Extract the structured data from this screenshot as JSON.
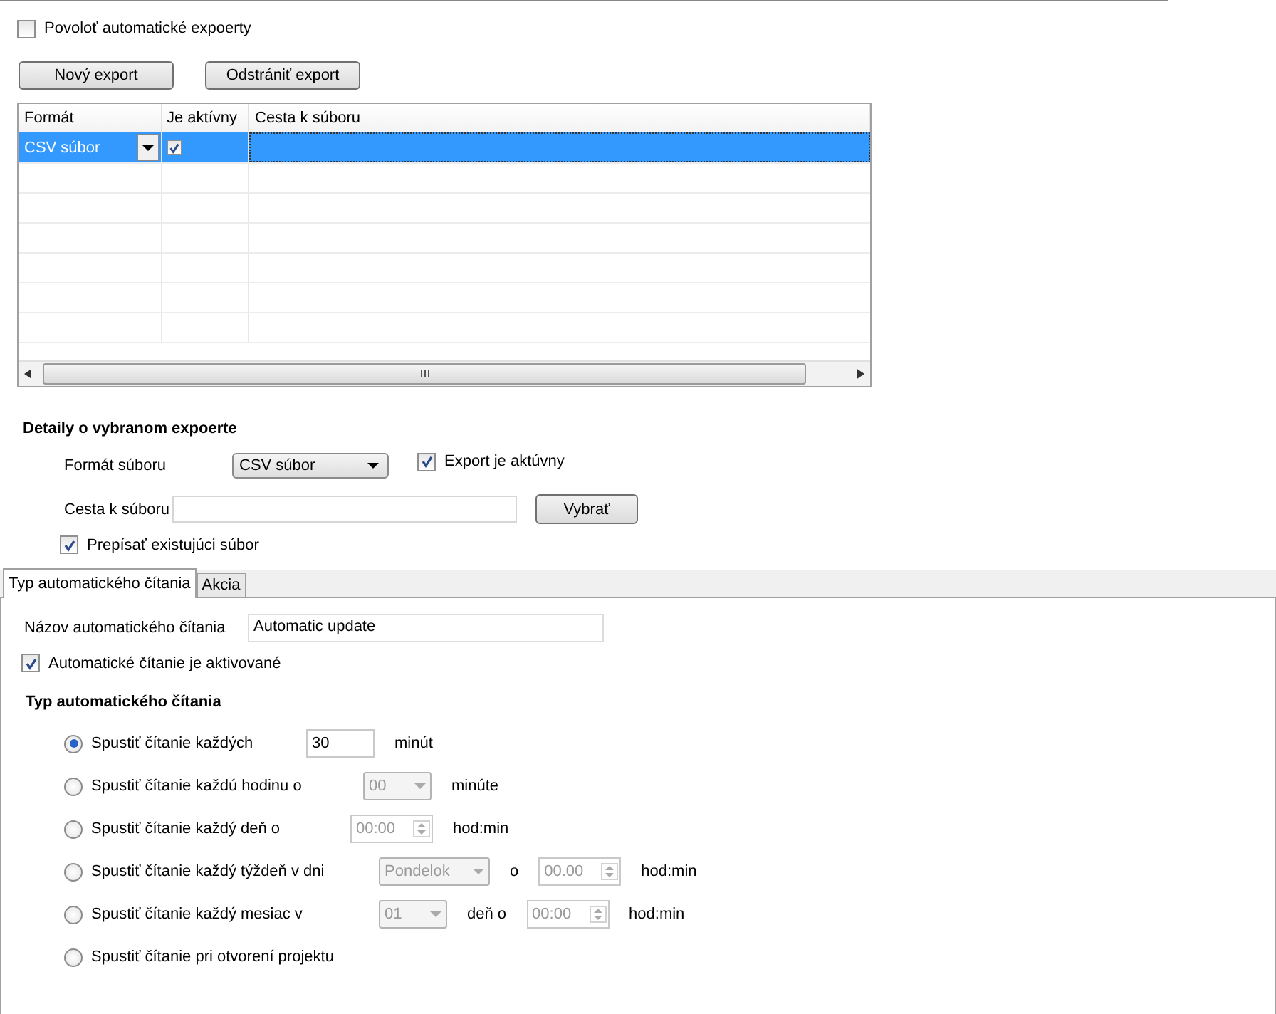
{
  "enable_auto_exports": {
    "label": "Povoloť automatické expoerty",
    "checked": false
  },
  "buttons": [
    "Nový export",
    "Odstrániť export"
  ],
  "table": {
    "columns": [
      "Formát",
      "Je aktívny",
      "Cesta k súboru"
    ],
    "rows": [
      {
        "format": "CSV súbor",
        "active": true,
        "path": "",
        "selected": true
      }
    ]
  },
  "details": {
    "title": "Detaily o vybranom expoerte",
    "format_label": "Formát súboru",
    "format_value": "CSV súbor",
    "active_label": "Export je aktúvny",
    "active_checked": true,
    "path_label": "Cesta k súboru",
    "browse_button": "Vybrať",
    "overwrite_label": "Prepísať existujúci súbor",
    "overwrite_checked": true
  },
  "tabs": [
    {
      "label": "Typ automatického čítania",
      "selected": true
    },
    {
      "label": "Akcia",
      "selected": false
    }
  ],
  "auto_read": {
    "name_label": "Názov automatického čítania",
    "name_value": "Automatic update",
    "activated_label": "Automatické čítanie je aktivované",
    "activated_checked": true,
    "section_title": "Typ automatického čítania",
    "options": [
      {
        "label": "Spustiť čítanie každých",
        "selected": true,
        "controls": [
          {
            "kind": "input",
            "value": "30",
            "disabled": false
          },
          {
            "kind": "text",
            "text": "minút"
          }
        ]
      },
      {
        "label": "Spustiť čítanie každú hodinu o",
        "selected": false,
        "controls": [
          {
            "kind": "dropdown",
            "value": "00",
            "disabled": true
          },
          {
            "kind": "text",
            "text": "minúte"
          }
        ]
      },
      {
        "label": "Spustiť čítanie každý deň o",
        "selected": false,
        "controls": [
          {
            "kind": "spinner",
            "value": "00:00",
            "disabled": true
          },
          {
            "kind": "text",
            "text": "hod:min"
          }
        ]
      },
      {
        "label": "Spustiť čítanie každý týždeň v dni",
        "selected": false,
        "controls": [
          {
            "kind": "dropdown",
            "value": "Pondelok",
            "disabled": true
          },
          {
            "kind": "text",
            "text": "o"
          },
          {
            "kind": "spinner",
            "value": "00.00",
            "disabled": true
          },
          {
            "kind": "text",
            "text": "hod:min"
          }
        ]
      },
      {
        "label": "Spustiť čítanie každý mesiac v",
        "selected": false,
        "controls": [
          {
            "kind": "dropdown",
            "value": "01",
            "disabled": true
          },
          {
            "kind": "text",
            "text": "deň o"
          },
          {
            "kind": "spinner",
            "value": "00:00",
            "disabled": true
          },
          {
            "kind": "text",
            "text": "hod:min"
          }
        ]
      },
      {
        "label": "Spustiť čítanie pri otvorení projektu",
        "selected": false
      }
    ]
  }
}
